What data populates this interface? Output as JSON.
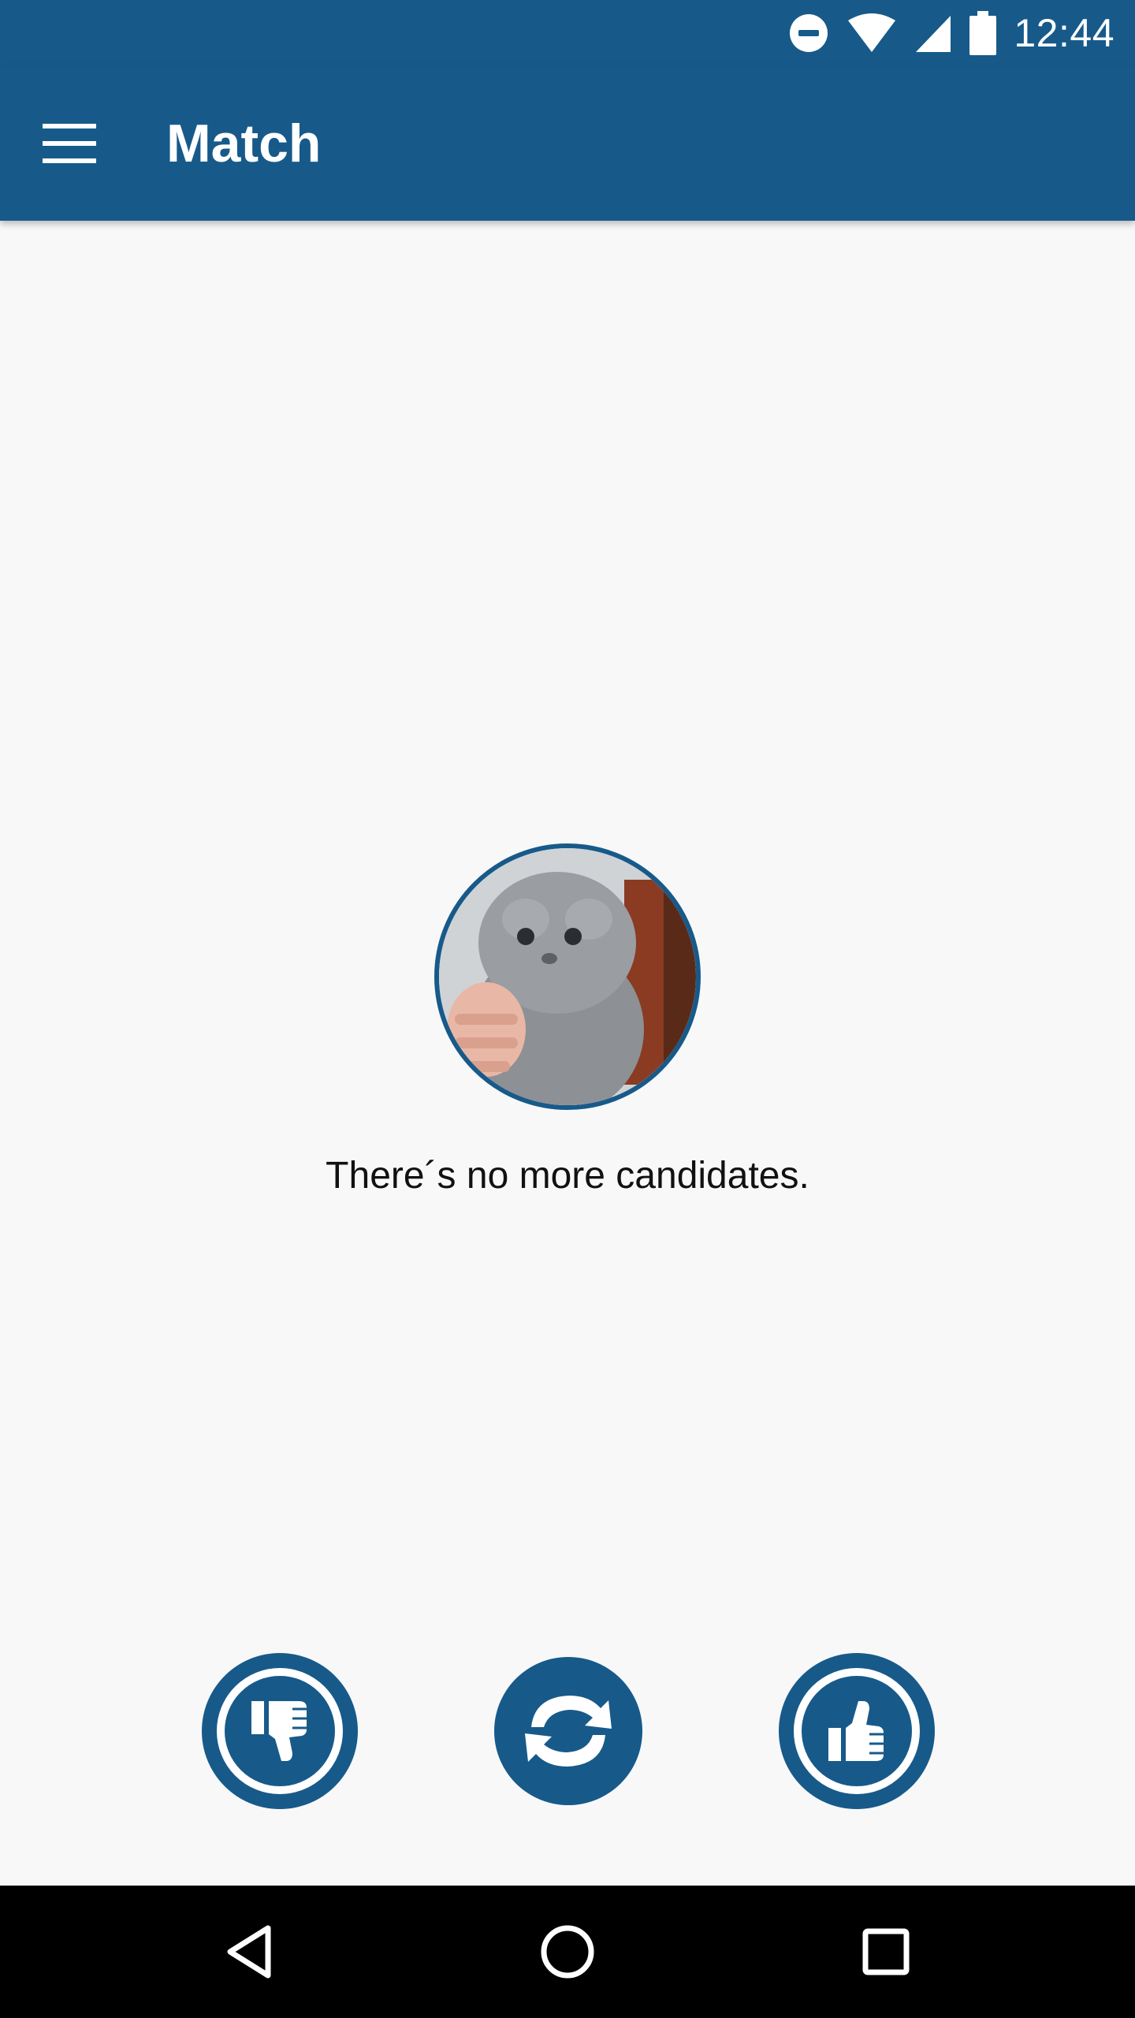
{
  "status_bar": {
    "time": "12:44",
    "icons": [
      "do-not-disturb-icon",
      "wifi-icon",
      "cell-signal-icon",
      "battery-icon"
    ]
  },
  "app_bar": {
    "title": "Match",
    "menu_icon": "hamburger-menu-icon"
  },
  "main": {
    "avatar_icon": "profile-photo-kitten",
    "empty_message": "There´s no more candidates."
  },
  "actions": {
    "dislike_icon": "thumbs-down-icon",
    "refresh_icon": "refresh-icon",
    "like_icon": "thumbs-up-icon"
  },
  "nav_bar": {
    "back_icon": "back-triangle-icon",
    "home_icon": "home-circle-icon",
    "recents_icon": "recents-square-icon"
  },
  "colors": {
    "primary": "#175a8a",
    "background": "#f8f8f9",
    "text": "#111111"
  }
}
